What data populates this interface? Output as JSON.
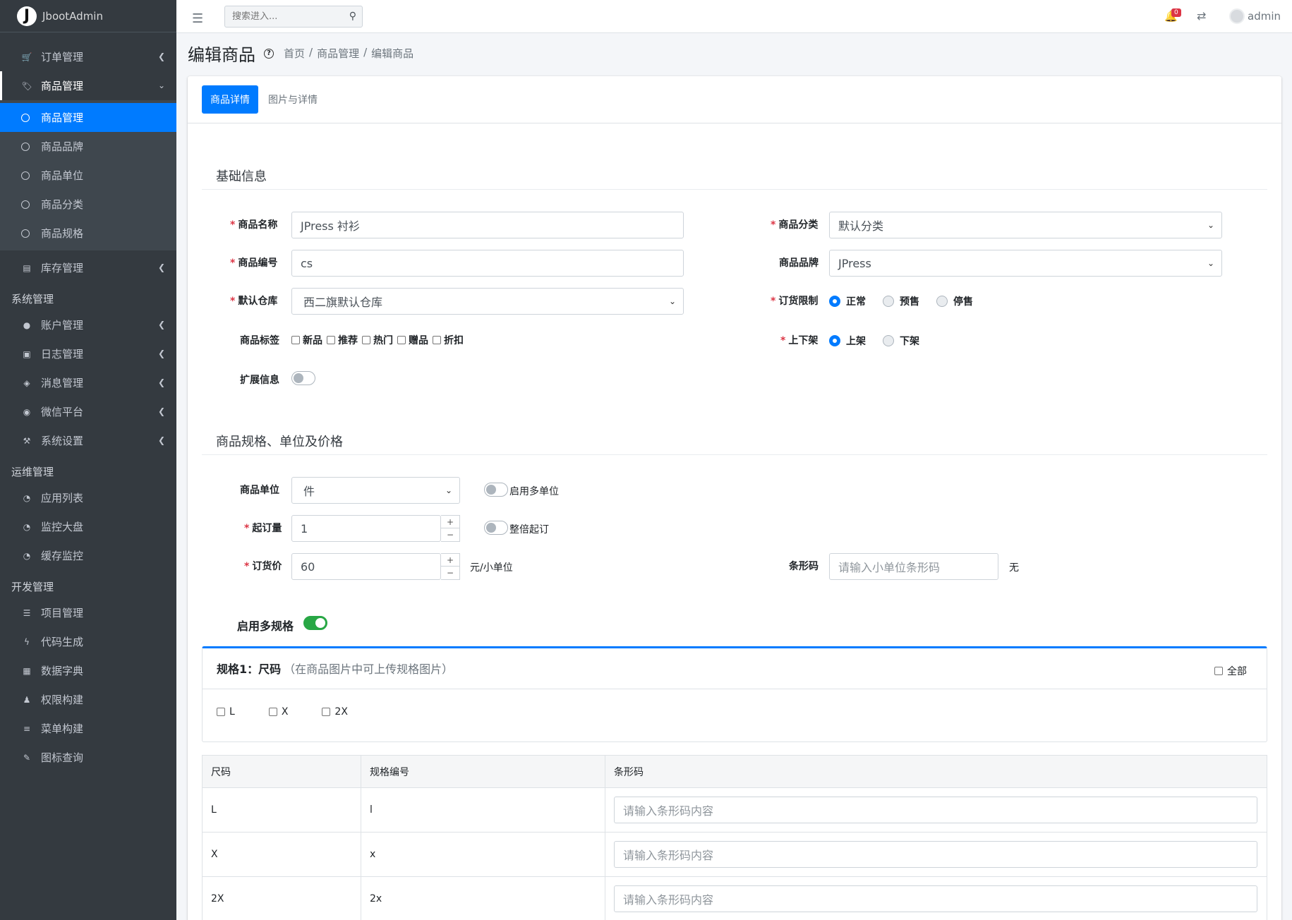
{
  "brand": {
    "logo": "J",
    "name": "JbootAdmin"
  },
  "sidebar": {
    "groups": [
      {
        "label": "订单管理",
        "icon": "cart-icon"
      },
      {
        "label": "商品管理",
        "icon": "tag-icon"
      }
    ],
    "sub_items": [
      "商品管理",
      "商品品牌",
      "商品单位",
      "商品分类",
      "商品规格"
    ],
    "inventory": "库存管理",
    "system_header": "系统管理",
    "system_items": [
      "账户管理",
      "日志管理",
      "消息管理",
      "微信平台",
      "系统设置"
    ],
    "ops_header": "运维管理",
    "ops_items": [
      "应用列表",
      "监控大盘",
      "缓存监控"
    ],
    "dev_header": "开发管理",
    "dev_items": [
      "项目管理",
      "代码生成",
      "数据字典",
      "权限构建",
      "菜单构建",
      "图标查询"
    ]
  },
  "topbar": {
    "search_placeholder": "搜索进入...",
    "badge": "0",
    "user": "admin"
  },
  "header": {
    "title": "编辑商品",
    "help": "?",
    "breadcrumb": [
      "首页",
      "/",
      "商品管理",
      "/",
      "编辑商品"
    ]
  },
  "tabs": [
    "商品详情",
    "图片与详情"
  ],
  "basic": {
    "section": "基础信息",
    "name_label": "商品名称",
    "name_value": "JPress 衬衫",
    "code_label": "商品编号",
    "code_value": "cs",
    "warehouse_label": "默认仓库",
    "warehouse_value": "西二旗默认仓库",
    "tags_label": "商品标签",
    "tags": [
      "新品",
      "推荐",
      "热门",
      "赠品",
      "折扣"
    ],
    "ext_label": "扩展信息",
    "category_label": "商品分类",
    "category_value": "默认分类",
    "brand_label": "商品品牌",
    "brand_value": "JPress",
    "limit_label": "订货限制",
    "limit_options": [
      "正常",
      "预售",
      "停售"
    ],
    "shelf_label": "上下架",
    "shelf_options": [
      "上架",
      "下架"
    ]
  },
  "spec": {
    "section": "商品规格、单位及价格",
    "unit_label": "商品单位",
    "unit_value": "件",
    "multi_unit": "启用多单位",
    "moq_label": "起订量",
    "moq_value": "1",
    "multiple": "整倍起订",
    "price_label": "订货价",
    "price_value": "60",
    "price_unit": "元/小单位",
    "barcode_label": "条形码",
    "barcode_placeholder": "请输入小单位条形码",
    "barcode_unit": "无",
    "multi_spec": "启用多规格",
    "spec1_title": "规格1：尺码",
    "spec1_hint": "（在商品图片中可上传规格图片）",
    "all": "全部",
    "options": [
      "L",
      "X",
      "2X"
    ],
    "table_headers": [
      "尺码",
      "规格编号",
      "条形码"
    ],
    "rows": [
      {
        "size": "L",
        "code": "l",
        "placeholder": "请输入条形码内容"
      },
      {
        "size": "X",
        "code": "x",
        "placeholder": "请输入条形码内容"
      },
      {
        "size": "2X",
        "code": "2x",
        "placeholder": "请输入条形码内容"
      }
    ]
  }
}
